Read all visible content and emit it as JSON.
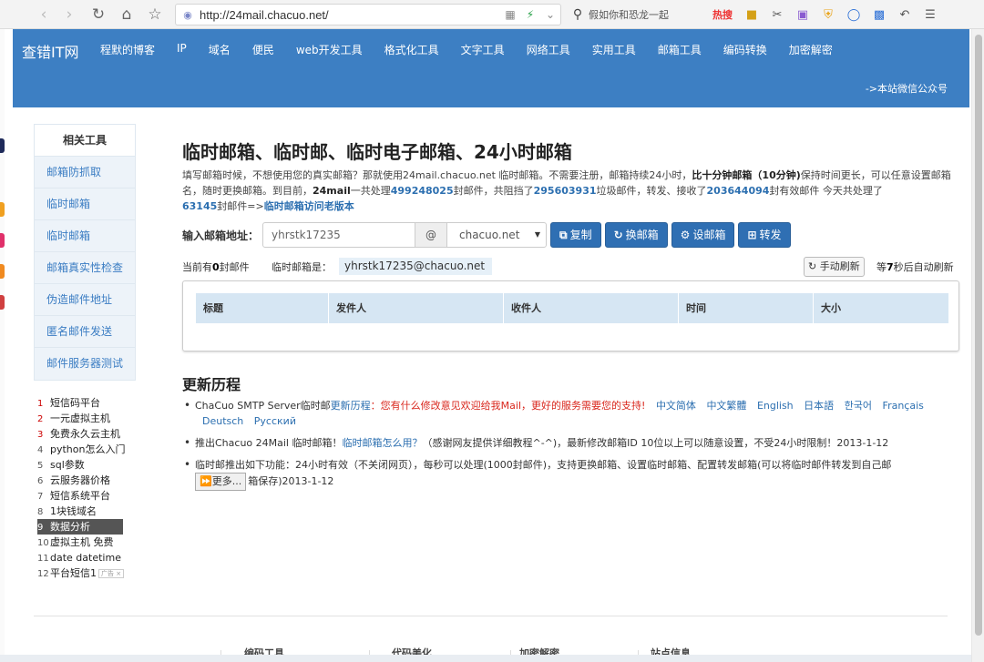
{
  "browser": {
    "url": "http://24mail.chacuo.net/",
    "search_text": "假如你和恐龙一起",
    "hot_label": "热搜"
  },
  "site": {
    "logo": "查错IT网",
    "nav": [
      "程默的博客",
      "IP",
      "域名",
      "便民",
      "web开发工具",
      "格式化工具",
      "文字工具",
      "网络工具",
      "实用工具",
      "邮箱工具",
      "编码转换",
      "加密解密"
    ],
    "wechat": "->本站微信公众号"
  },
  "sidebar": {
    "title": "相关工具",
    "items": [
      "邮箱防抓取",
      "临时邮箱",
      "临时邮箱",
      "邮箱真实性检查",
      "伪造邮件地址",
      "匿名邮件发送",
      "邮件服务器测试"
    ]
  },
  "ads": [
    {
      "n": "1",
      "text": "短信码平台"
    },
    {
      "n": "2",
      "text": "一元虚拟主机"
    },
    {
      "n": "3",
      "text": "免费永久云主机"
    },
    {
      "n": "4",
      "text": "python怎么入门"
    },
    {
      "n": "5",
      "text": "sql参数"
    },
    {
      "n": "6",
      "text": "云服务器价格"
    },
    {
      "n": "7",
      "text": "短信系统平台"
    },
    {
      "n": "8",
      "text": "1块钱域名"
    },
    {
      "n": "9",
      "text": "数据分析"
    },
    {
      "n": "10",
      "text": "虚拟主机 免费"
    },
    {
      "n": "11",
      "text": "date datetime"
    },
    {
      "n": "12",
      "text": "平台短信1"
    }
  ],
  "ad_close": "广告 ×",
  "main": {
    "title": "临时邮箱、临时邮、临时电子邮箱、24小时邮箱",
    "intro_1": "填写邮箱时候，不想使用您的真实邮箱？那就使用24mail.chacuo.net 临时邮箱。不需要注册，邮箱持续24小时，",
    "intro_bold": "比十分钟邮箱（10分钟)",
    "intro_2": "保持时间更长，可以任意设置邮箱名，随时更换邮箱。到目前，",
    "intro_brand": "24mail",
    "intro_3": "一共处理",
    "processed": "499248025",
    "intro_4": "封邮件，共阻挡了",
    "blocked": "295603931",
    "intro_5": "垃圾邮件，转发、接收了",
    "received": "203644094",
    "intro_6": "封有效邮件 今天共处理了",
    "today": "63145",
    "intro_7": "封邮件=>",
    "old_link": "临时邮箱访问老版本",
    "email_label": "输入邮箱地址：",
    "email_value": "yhrstk17235",
    "at": "@",
    "domain": "chacuo.net",
    "btn_copy": "复制",
    "btn_change": "换邮箱",
    "btn_settings": "设邮箱",
    "btn_forward": "转发",
    "count_pre": "当前有",
    "count": "0",
    "count_post": "封邮件",
    "current_label": "临时邮箱是：",
    "current_address": "yhrstk17235@chacuo.net",
    "refresh_label": "手动刷新",
    "auto_pre": "等",
    "auto_seconds": "7",
    "auto_post": "秒后自动刷新",
    "columns": [
      "标题",
      "发件人",
      "收件人",
      "时间",
      "大小"
    ]
  },
  "updates": {
    "title": "更新历程",
    "u1_text": "ChaCuo SMTP Server临时邮",
    "u1_link": "更新历程",
    "u1_red": "：您有什么修改意见欢迎给我Mail，更好的服务需要您的支持!",
    "languages": [
      "中文简体",
      "中文繁體",
      "English",
      "日本語",
      "한국어",
      "Français",
      "Deutsch",
      "Русский"
    ],
    "u2_a": "推出Chacuo 24Mail 临时邮箱！",
    "u2_link": "临时邮箱怎么用？",
    "u2_b": "（感谢网友提供详细教程^-^)，最新修改邮箱ID 10位以上可以随意设置，不受24小时限制！2013-1-12",
    "u3_a": "临时邮推出如下功能：24小时有效（不关闭网页），每秒可以处理(1000封邮件)，支持更换邮箱、设置临时邮箱、配置转发邮箱(可以将临时邮件转发到自己邮",
    "more_label": "更多...",
    "u3_b": "箱保存)2013-1-12"
  },
  "footer": [
    "编码工具",
    "代码美化",
    "加密解密",
    "站点信息"
  ]
}
